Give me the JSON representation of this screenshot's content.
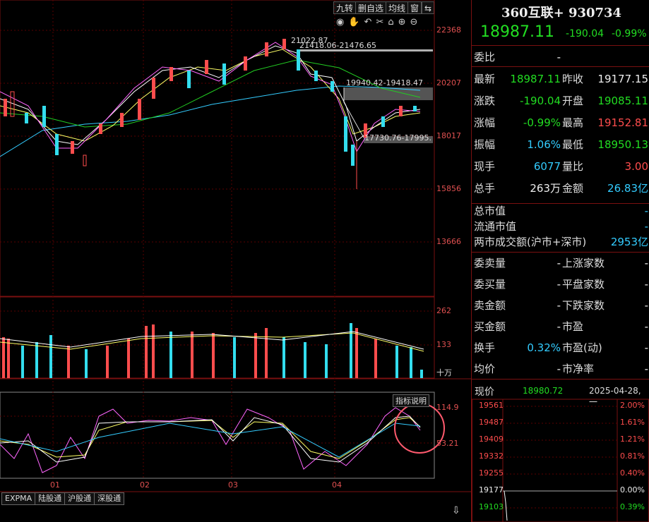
{
  "toolbar": {
    "buttons": [
      "九转",
      "删自选",
      "均线",
      "窗",
      "⇆"
    ]
  },
  "icons": [
    "eye-icon",
    "hand-icon",
    "undo-icon",
    "scissors-icon",
    "lock-icon",
    "zoom-in-icon",
    "zoom-out-icon"
  ],
  "colors": {
    "up": "#ff4d4d",
    "down": "#33ddee",
    "green": "#22dd22",
    "cyan": "#33ccff",
    "border": "#7a1010"
  },
  "price_axis": [
    "22368",
    "20207",
    "18017",
    "15856",
    "13666"
  ],
  "volume_axis": [
    "262",
    "133",
    "十万"
  ],
  "indicator_axis": {
    "top": "114.9",
    "mid": "53.21"
  },
  "indicator_button": "指标说明",
  "x_axis": [
    "01",
    "02",
    "03",
    "04"
  ],
  "annotations": {
    "high_range": "21418.06-21476.65",
    "mid_range": "19940.42-19418.47",
    "low_range": "17730.76-17995.",
    "top_label": "21022.87"
  },
  "tabs": [
    "EXPMA",
    "陆股通",
    "沪股通",
    "深股通"
  ],
  "download_icon": "download-icon",
  "chart_data": {
    "type": "candlestick",
    "x": [
      "01",
      "02",
      "03",
      "04"
    ],
    "series": [],
    "ylim": [
      13666,
      22368
    ]
  },
  "quote": {
    "name": "360互联+",
    "code": "930734",
    "price": "18987.11",
    "change": "-190.04",
    "pct": "-0.99%"
  },
  "rows": [
    {
      "l1": "委比",
      "v1": "-",
      "l2": "",
      "v2": ""
    },
    {
      "l1": "最新",
      "v1": "18987.11",
      "l2": "昨收",
      "v2": "19177.15"
    },
    {
      "l1": "涨跌",
      "v1": "-190.04",
      "l2": "开盘",
      "v2": "19085.11"
    },
    {
      "l1": "涨幅",
      "v1": "-0.99%",
      "l2": "最高",
      "v2": "19152.81"
    },
    {
      "l1": "振幅",
      "v1": "1.06%",
      "l2": "最低",
      "v2": "18950.13"
    },
    {
      "l1": "现手",
      "v1": "6077",
      "l2": "量比",
      "v2": "3.00"
    },
    {
      "l1": "总手",
      "v1": "263万",
      "l2": "金额",
      "v2": "26.83亿"
    }
  ],
  "market": [
    {
      "l": "总市值",
      "v": "-"
    },
    {
      "l": "流通市值",
      "v": "-"
    },
    {
      "l": "两市成交额(沪市+深市)",
      "v": "2953亿"
    }
  ],
  "orders": [
    {
      "l1": "委卖量",
      "v1": "-",
      "l2": "上涨家数",
      "v2": "-"
    },
    {
      "l1": "委买量",
      "v1": "-",
      "l2": "平盘家数",
      "v2": "-"
    },
    {
      "l1": "卖金额",
      "v1": "-",
      "l2": "下跌家数",
      "v2": "-"
    },
    {
      "l1": "买金额",
      "v1": "-",
      "l2": "市盈",
      "v2": "-"
    },
    {
      "l1": "换手",
      "v1": "0.32%",
      "l2": "市盈(动)",
      "v2": "-"
    },
    {
      "l1": "均价",
      "v1": "-",
      "l2": "市净率",
      "v2": "-"
    }
  ],
  "intraday": {
    "label": "现价",
    "price": "18980.72",
    "date": "2025-04-28,一",
    "levels": [
      {
        "p": "19561",
        "pct": "2.00%"
      },
      {
        "p": "19487",
        "pct": "1.61%"
      },
      {
        "p": "19409",
        "pct": "1.21%"
      },
      {
        "p": "19332",
        "pct": "0.81%"
      },
      {
        "p": "19255",
        "pct": "0.40%"
      },
      {
        "p": "19177",
        "pct": "0.00%"
      },
      {
        "p": "19103",
        "pct": "0.39%"
      }
    ]
  }
}
